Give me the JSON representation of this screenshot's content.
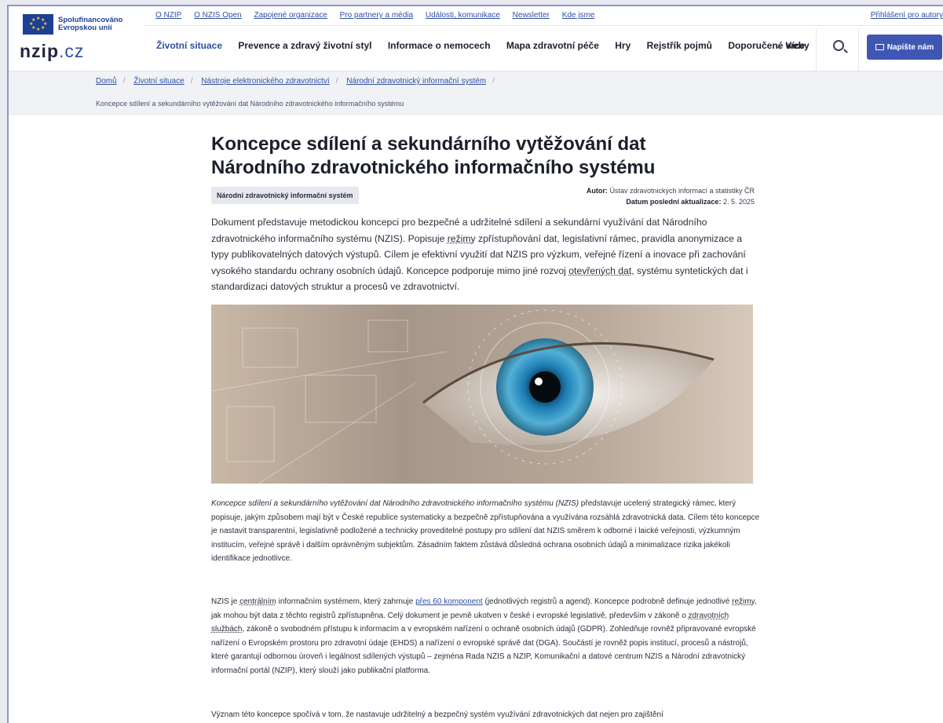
{
  "eu": {
    "line1": "Spolufinancováno",
    "line2": "Evropskou unií"
  },
  "logo": {
    "brand": "nzip",
    "tld": ".cz"
  },
  "toplinks": [
    "O NZIP",
    "O NZIS Open",
    "Zapojené organizace",
    "Pro partnery a média",
    "Události, komunikace",
    "Newsletter",
    "Kde jsme"
  ],
  "login": "Přihlášení pro autory",
  "nav": [
    "Životní situace",
    "Prevence a zdravý životní styl",
    "Informace o nemocech",
    "Mapa zdravotní péče",
    "Hry",
    "Rejstřík pojmů",
    "Doporučené weby"
  ],
  "nav_more": "Více",
  "write_button": "Napište nám",
  "breadcrumb": [
    "Domů",
    "Životní situace",
    "Nástroje elektronického zdravotnictví",
    "Národní zdravotnický informační systém"
  ],
  "breadcrumb_current": "Koncepce sdílení a sekundárního vytěžování dat Národního zdravotnického informačního systému",
  "article": {
    "title_line1": "Koncepce sdílení a sekundárního vytěžování dat",
    "title_line2": "Národního zdravotnického informačního systému",
    "tag": "Národní zdravotnický informační systém",
    "author_label": "Autor:",
    "author": "Ústav zdravotnických informací a statistiky ČR",
    "updated_label": "Datum poslední aktualizace:",
    "updated": "2. 5. 2025",
    "lead_1": "Dokument představuje metodickou koncepci pro bezpečné a udržitelné sdílení a sekundární využívání dat Národního zdravotnického informačního systému (NZIS). Popisuje ",
    "lead_u1": "režimy",
    "lead_2": " zpřístupňování dat, legislativní rámec, pravidla anonymizace a typy publikovatelných datových výstupů. Cílem je efektivní využití dat NZIS pro výzkum, veřejné řízení a inovace při zachování vysokého standardu ochrany osobních údajů. Koncepce podporuje mimo jiné rozvoj ",
    "lead_u2": "otevřených dat",
    "lead_3": ", systému syntetických dat i standardizaci datových struktur a procesů ve zdravotnictví.",
    "p1_italic": "Koncepce sdílení a sekundárního vytěžování dat Národního zdravotnického informačního systému (NZIS)",
    "p1": " představuje ucelený strategický rámec, který popisuje, jakým způsobem mají být v České republice systematicky a bezpečně zpřístupňována a využívána rozsáhlá zdravotnická data. Cílem této koncepce je nastavit transparentní, legislativně podložené a technicky proveditelné postupy pro sdílení dat NZIS směrem k odborné i laické veřejnosti, výzkumným institucím, veřejné správě i dalším oprávněným subjektům. Zásadním faktem zůstává důsledná ochrana osobních údajů a minimalizace rizika jakékoli identifikace jednotlivce.",
    "p2_a": "NZIS je ",
    "p2_u1": "centrálním",
    "p2_b": " informačním systémem, který zahrnuje ",
    "p2_link": "přes 60 komponent",
    "p2_c": " (jednotlivých registrů a agend). Koncepce podrobně definuje jednotlivé ",
    "p2_u2": "režimy",
    "p2_d": ", jak mohou být data z těchto registrů zpřístupněna. Celý dokument je pevně ukotven v české i evropské legislativě, především v zákoně o ",
    "p2_u3": "zdravotních službách",
    "p2_e": ", zákoně o svobodném přístupu k informacím a v evropském nařízení o ochraně osobních údajů (GDPR). Zohledňuje rovněž připravované evropské nařízení o Evropském prostoru pro zdravotní údaje (EHDS) a nařízení o evropské správě dat (DGA). Součástí je rovněž popis institucí, procesů a nástrojů, které garantují odbornou úroveň i legálnost sdílených výstupů – zejména Rada NZIS a NZIP, Komunikační a datové centrum NZIS a Národní zdravotnický informační portál (NZIP), který slouží jako publikační platforma.",
    "p3": "Význam této koncepce spočívá v tom, že nastavuje udržitelný a bezpečný systém využívání zdravotnických dat nejen pro zajištění"
  }
}
